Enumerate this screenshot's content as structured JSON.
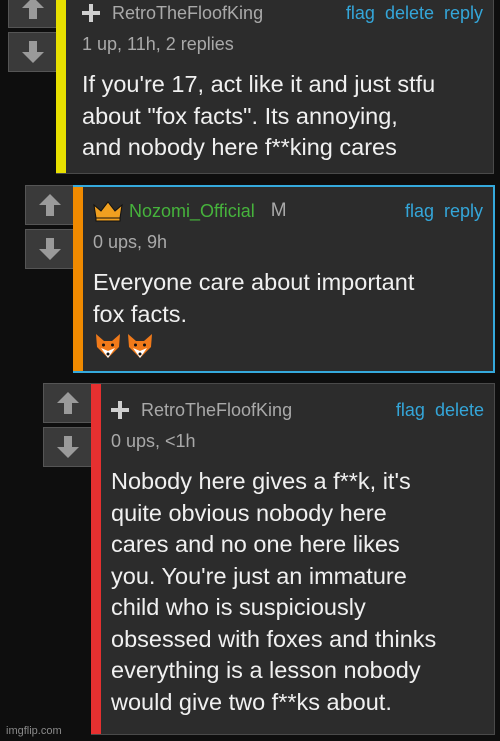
{
  "comments": [
    {
      "username": "RetroTheFloofKing",
      "meta": "1 up, 11h, 2 replies",
      "body": "If you're 17, act like it and just stfu\nabout \"fox facts\". Its annoying,\nand nobody here f**king cares",
      "actions": [
        "flag",
        "delete",
        "reply"
      ],
      "accent_color": "#e8e000"
    },
    {
      "username": "Nozomi_Official",
      "mod_badge": "M",
      "meta": "0 ups, 9h",
      "body": "Everyone care about important\nfox facts.",
      "emoji": [
        "fox-emoji",
        "fox-emoji"
      ],
      "actions": [
        "flag",
        "reply"
      ],
      "accent_color": "#f08a00",
      "border_color": "#35a9dc"
    },
    {
      "username": "RetroTheFloofKing",
      "meta": "0 ups, <1h",
      "body": "Nobody here gives a f**k, it's\nquite obvious nobody here\ncares and no one here likes\nyou. You're just an immature\nchild who is suspiciously\nobsessed with foxes and thinks\neverything is a lesson nobody\nwould give two f**ks about.",
      "actions": [
        "flag",
        "delete"
      ],
      "accent_color": "#e53030"
    }
  ],
  "watermark": "imgflip.com",
  "colors": {
    "link": "#34a6d9",
    "mod_name": "#46b33c"
  }
}
